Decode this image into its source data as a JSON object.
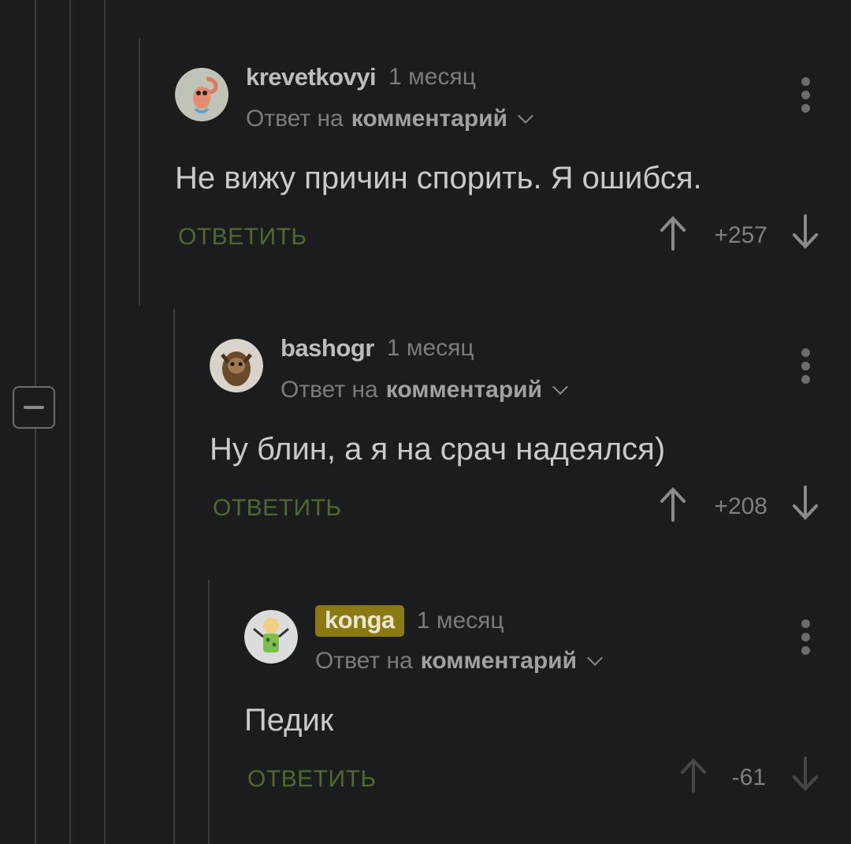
{
  "comments": [
    {
      "author": "krevetkovyi",
      "time": "1 месяц",
      "reply_prefix": "Ответ на",
      "reply_target": "комментарий",
      "text": "Не вижу причин спорить. Я ошибся.",
      "reply_label": "ОТВЕТИТЬ",
      "score": "+257"
    },
    {
      "author": "bashogr",
      "time": "1 месяц",
      "reply_prefix": "Ответ на",
      "reply_target": "комментарий",
      "text": "Ну блин, а я на срач надеялся)",
      "reply_label": "ОТВЕТИТЬ",
      "score": "+208"
    },
    {
      "author": "konga",
      "time": "1 месяц",
      "reply_prefix": "Ответ на",
      "reply_target": "комментарий",
      "text": "Педик",
      "reply_label": "ОТВЕТИТЬ",
      "score": "-61"
    }
  ],
  "colors": {
    "background": "#1b1c1e",
    "reply_link": "#4d6b2f",
    "author_badge": "#8b7a12"
  }
}
